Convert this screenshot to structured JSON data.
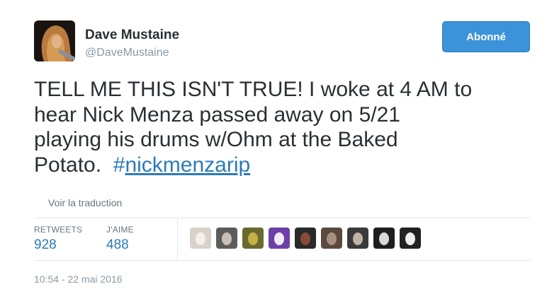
{
  "author": {
    "display_name": "Dave Mustaine",
    "screen_name": "@DaveMustaine",
    "avatar_icon": "profile-photo-long-hair-guitar"
  },
  "follow_button": {
    "label": "Abonné"
  },
  "tweet": {
    "lines": [
      "TELL ME THIS ISN'T TRUE! I woke at 4 AM to",
      "hear Nick Menza  passed away on 5/21",
      "playing his drums w/Ohm at the Baked",
      "Potato.  "
    ],
    "hashtag_symbol": "#",
    "hashtag_text": "nickmenzarip"
  },
  "translate_link": "Voir la traduction",
  "stats": {
    "retweets_label": "RETWEETS",
    "retweets_value": "928",
    "likes_label": "J'AIME",
    "likes_value": "488"
  },
  "likers": [
    {
      "icon": "white-dog-avatar",
      "bg": "#d9d2c8",
      "fg": "#f4f1ec"
    },
    {
      "icon": "bearded-man-avatar",
      "bg": "#5c5c5c",
      "fg": "#c9bfb4"
    },
    {
      "icon": "cartoon-character-avatar",
      "bg": "#6b6a2e",
      "fg": "#c8b048"
    },
    {
      "icon": "purple-egg-avatar",
      "bg": "#6e3fa8",
      "fg": "#f2ecfa"
    },
    {
      "icon": "dark-figure-avatar",
      "bg": "#2a2a2a",
      "fg": "#8a4a3a"
    },
    {
      "icon": "brown-photo-avatar",
      "bg": "#5a4a3e",
      "fg": "#a89080"
    },
    {
      "icon": "guitarist-avatar",
      "bg": "#3a3a3a",
      "fg": "#bdb3a6"
    },
    {
      "icon": "bw-band-avatar",
      "bg": "#1e1e1e",
      "fg": "#d8d8d8"
    },
    {
      "icon": "kanji-text-avatar",
      "bg": "#222222",
      "fg": "#eeeeee"
    }
  ],
  "timestamp": "10:54 - 22 mai 2016"
}
